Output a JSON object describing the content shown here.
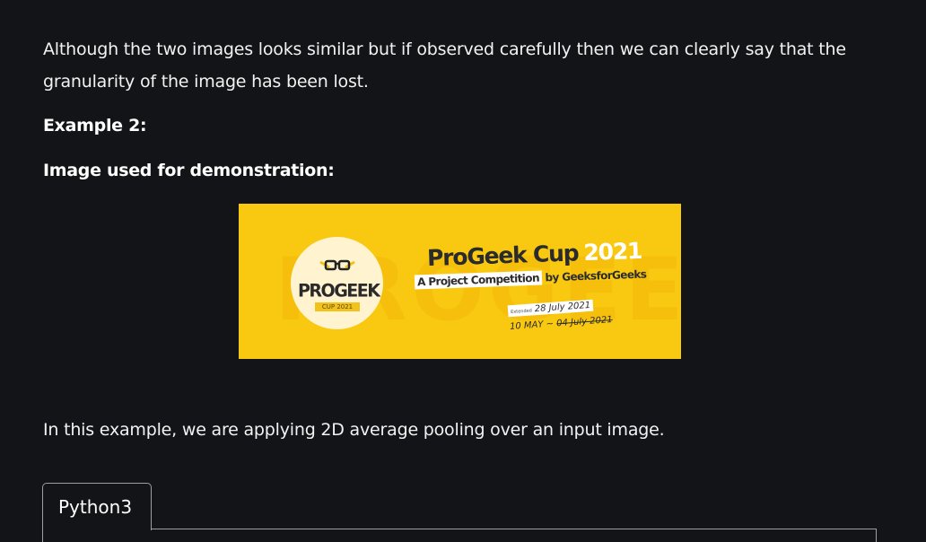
{
  "article": {
    "paragraph_1": "Although the two images looks similar but if observed carefully then we can clearly say that the granularity of the image has been lost.",
    "heading_example": "Example 2:",
    "heading_image": "Image used for demonstration:",
    "paragraph_2": "In this example, we are applying 2D average pooling over an input image."
  },
  "banner": {
    "logo_word": "PROGEEK",
    "logo_sub": "CUP 2021",
    "title": "ProGeek Cup",
    "title_year": "2021",
    "tagline_box": "A Project Competition",
    "tagline_rest": "by GeeksforGeeks",
    "extended_label": "Extended",
    "new_end_date": "28 July 2021",
    "start_date": "10 MAY",
    "date_separator": "~",
    "old_end_date": "04 July 2021",
    "colors": {
      "background": "#f9c912",
      "circle": "#fff4cf",
      "text": "#2b2b2b"
    }
  },
  "code_block": {
    "tab_label": "Python3"
  },
  "colors": {
    "page_background": "#131417",
    "text": "#ffffff",
    "border": "#9aa0a6"
  }
}
